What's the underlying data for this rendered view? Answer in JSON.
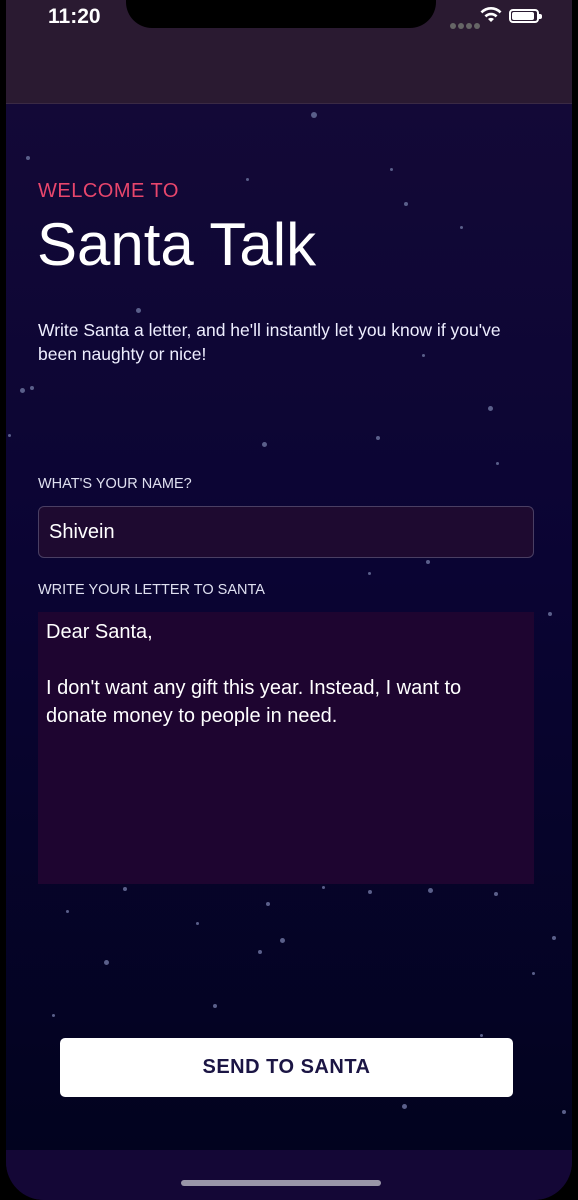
{
  "status_bar": {
    "time": "11:20",
    "icons": [
      "signal-icon",
      "wifi-icon",
      "battery-icon"
    ]
  },
  "header": {
    "welcome": "WELCOME TO",
    "title": "Santa Talk",
    "intro": "Write Santa a letter, and he'll instantly let you know if you've been naughty or nice!"
  },
  "form": {
    "name_label": "WHAT'S YOUR NAME?",
    "name_value": "Shivein",
    "letter_label": "WRITE YOUR LETTER TO SANTA",
    "letter_value": "Dear Santa,\n\nI don't want any gift this year. Instead, I want to donate money to people in need.",
    "send_label": "SEND TO SANTA"
  },
  "colors": {
    "accent": "#e8466c",
    "background_top": "#130937",
    "background_bottom": "#02031f",
    "field_background": "#1e0a30",
    "button_text": "#1b1544"
  }
}
